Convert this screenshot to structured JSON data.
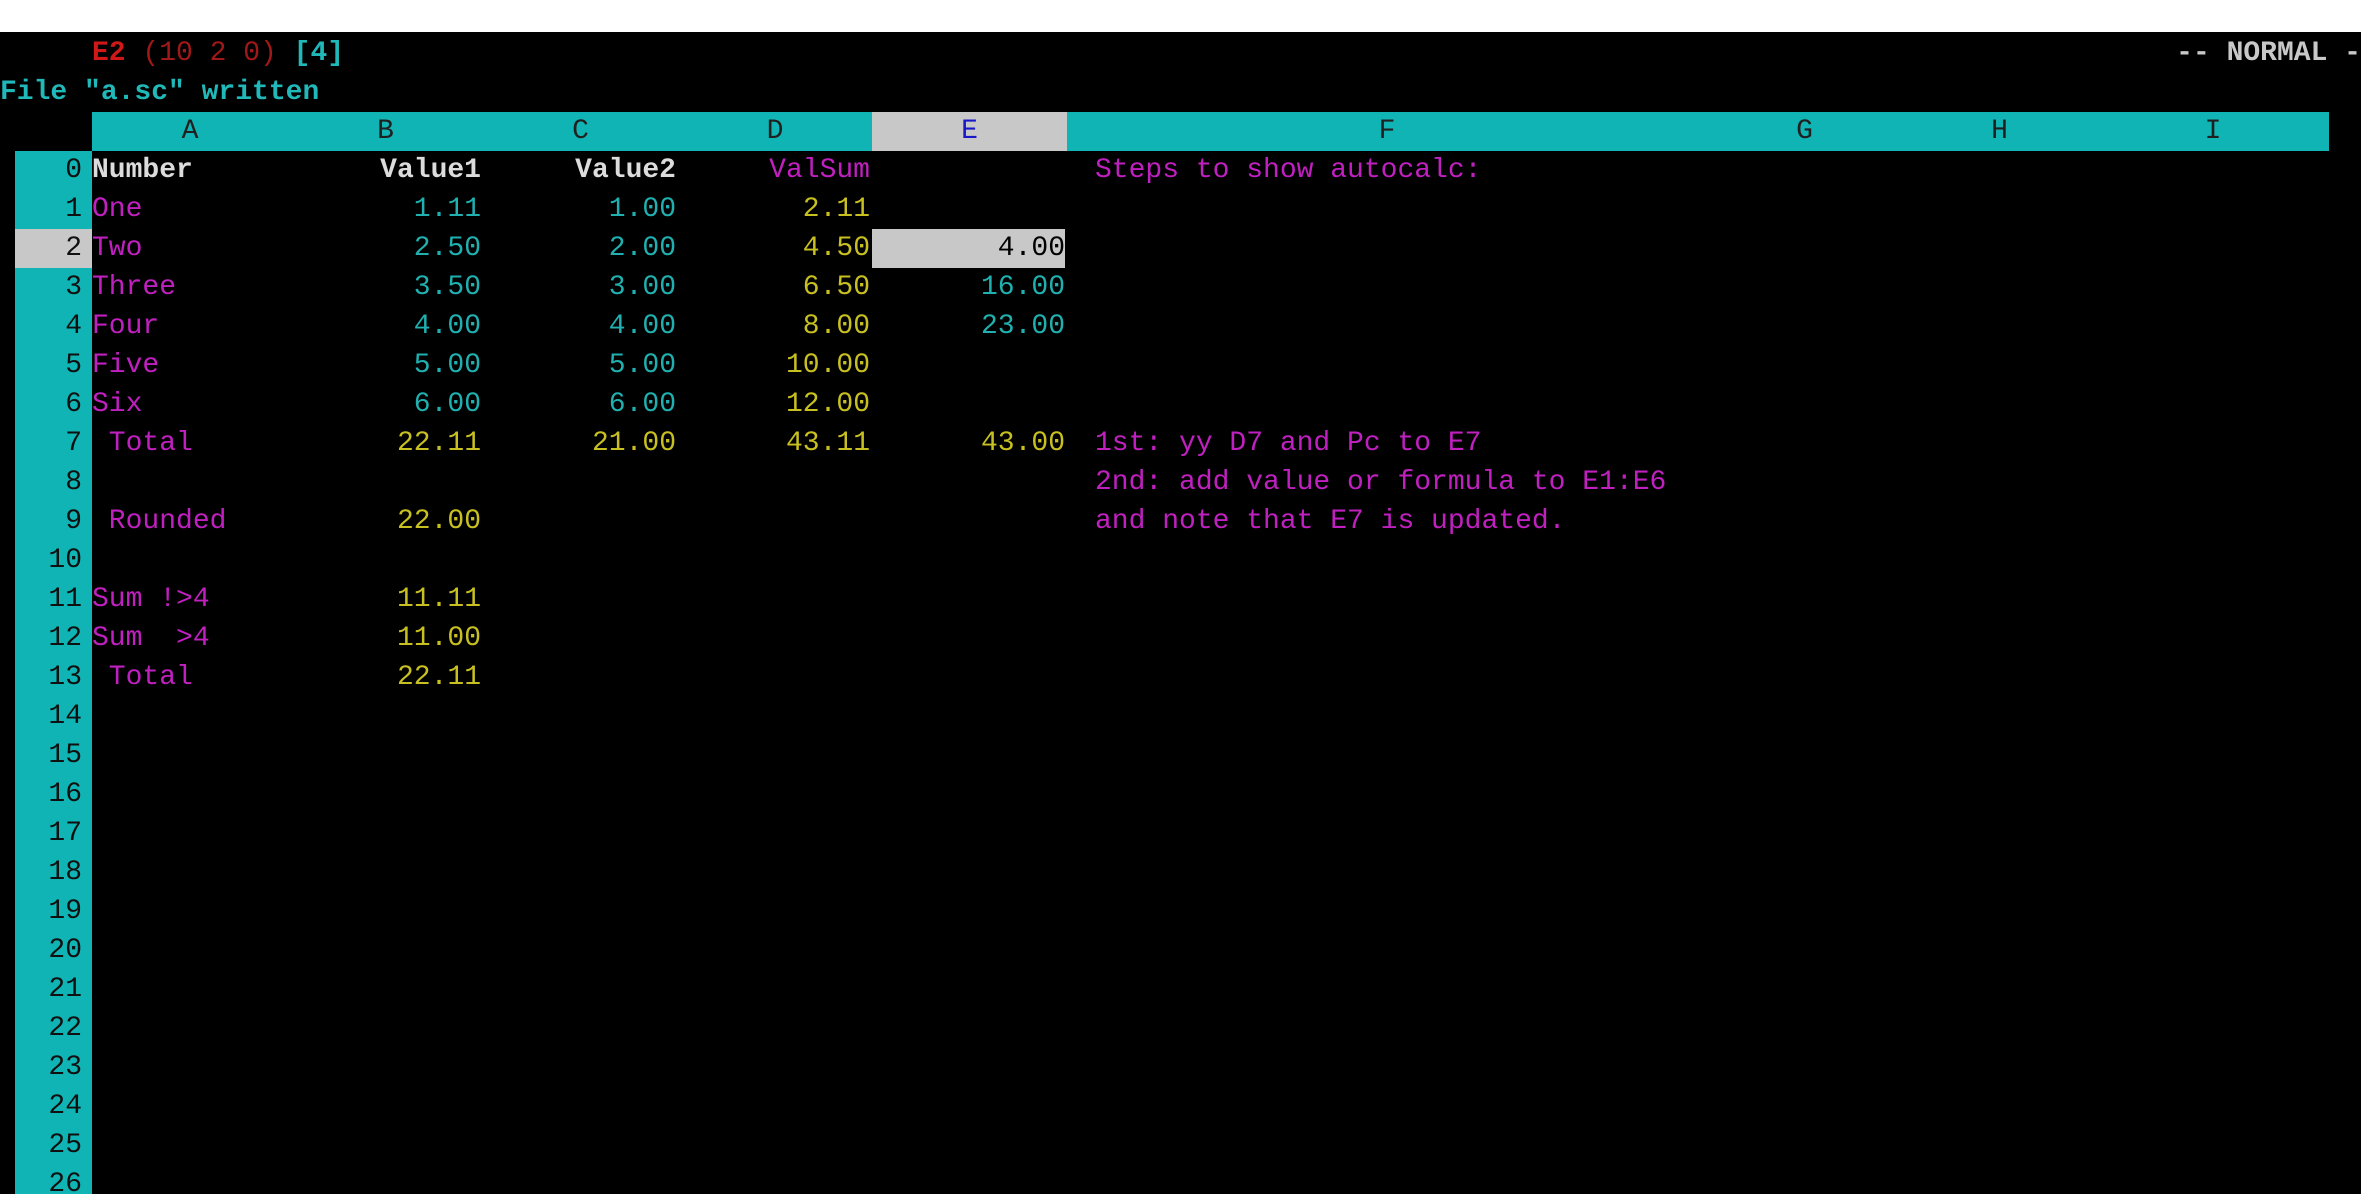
{
  "status": {
    "cell_ref": "E2",
    "coords": "(10 2 0)",
    "count": "[4]",
    "mode": "-- NORMAL -"
  },
  "message": "File \"a.sc\" written",
  "columns": [
    "A",
    "B",
    "C",
    "D",
    "E",
    "F",
    "G",
    "H",
    "I"
  ],
  "selected_column": "E",
  "rows": [
    "0",
    "1",
    "2",
    "3",
    "4",
    "5",
    "6",
    "7",
    "8",
    "9",
    "10",
    "11",
    "12",
    "13",
    "14",
    "15",
    "16",
    "17",
    "18",
    "19",
    "20",
    "21",
    "22",
    "23",
    "24",
    "25",
    "26"
  ],
  "selected_row": "2",
  "cells": {
    "A0": "Number",
    "B0": "Value1",
    "C0": "Value2",
    "D0": "ValSum",
    "F0": "Steps to show autocalc:",
    "A1": "One",
    "B1": "1.11",
    "C1": "1.00",
    "D1": "2.11",
    "A2": "Two",
    "B2": "2.50",
    "C2": "2.00",
    "D2": "4.50",
    "E2": "4.00",
    "A3": "Three",
    "B3": "3.50",
    "C3": "3.00",
    "D3": "6.50",
    "E3": "16.00",
    "A4": "Four",
    "B4": "4.00",
    "C4": "4.00",
    "D4": "8.00",
    "E4": "23.00",
    "A5": "Five",
    "B5": "5.00",
    "C5": "5.00",
    "D5": "10.00",
    "A6": "Six",
    "B6": "6.00",
    "C6": "6.00",
    "D6": "12.00",
    "A7": " Total",
    "B7": "22.11",
    "C7": "21.00",
    "D7": "43.11",
    "E7": "43.00",
    "F7": "1st: yy D7 and Pc to E7",
    "F8": "2nd: add value or formula to E1:E6",
    "A9": " Rounded",
    "B9": "22.00",
    "F9": "and note that E7 is updated.",
    "A11": "Sum !>4",
    "B11": "11.11",
    "A12": "Sum  >4",
    "B12": "11.00",
    "A13": " Total",
    "B13": "22.11"
  },
  "colors": {
    "header_bg": "#10b4b4",
    "selection_bg": "#c8c8c8",
    "label_magenta": "#c020c0",
    "value_cyan": "#20b0b0",
    "value_yellow": "#c8c020"
  }
}
